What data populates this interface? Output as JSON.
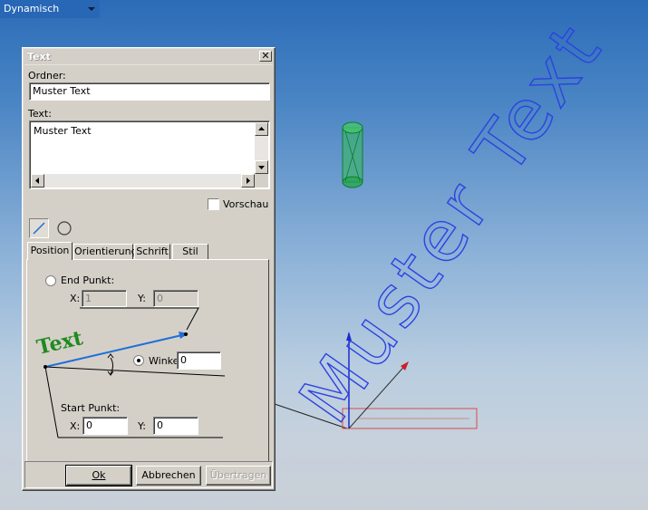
{
  "toolbar": {
    "mode_select": "Dynamisch"
  },
  "dialog": {
    "title": "Text",
    "ordner_label": "Ordner:",
    "ordner_value": "Muster Text",
    "text_label": "Text:",
    "text_value": "Muster Text",
    "vorschau_label": "Vorschau",
    "tabs": [
      "Position",
      "Orientierung",
      "Schrift",
      "Stil"
    ],
    "active_tab": "Position",
    "end_point_label": "End Punkt:",
    "end_x_label": "X:",
    "end_x_value": "1",
    "end_y_label": "Y:",
    "end_y_value": "0",
    "angle_label": "Winkel",
    "angle_value": "0",
    "diagram_text": "Text",
    "start_point_label": "Start Punkt:",
    "start_x_label": "X:",
    "start_x_value": "0",
    "start_y_label": "Y:",
    "start_y_value": "0",
    "buttons": {
      "ok": "Ok",
      "cancel": "Abbrechen",
      "apply": "Übertragen"
    }
  },
  "viewport": {
    "text3d": "Muster Text"
  },
  "colors": {
    "text3d": "#2c42e0",
    "cylinder": "#22a544",
    "logo_text": "#1f8a1f",
    "arrow": "#1d6fd8"
  }
}
